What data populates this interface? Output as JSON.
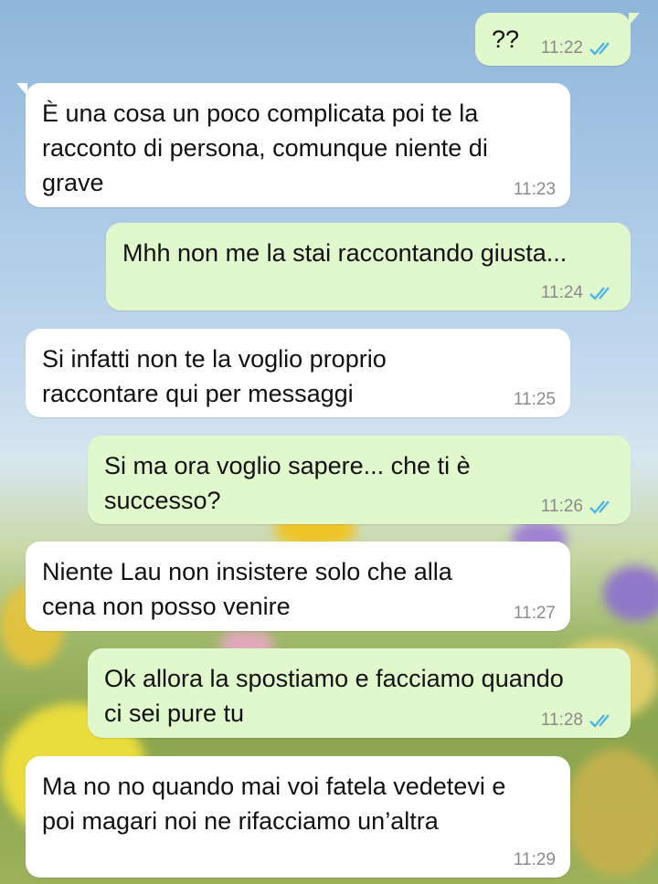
{
  "colors": {
    "incoming_bubble": "#ffffff",
    "outgoing_bubble": "#e1f8cd",
    "read_ticks": "#4fb4e8",
    "timestamp": "#8a8a8a"
  },
  "messages": [
    {
      "direction": "out",
      "text": "??",
      "time": "11:22",
      "status": "read-double-check-icon"
    },
    {
      "direction": "in",
      "text": "È una cosa un poco complicata poi te la\nracconto di persona, comunque niente di\ngrave",
      "time": "11:23"
    },
    {
      "direction": "out",
      "text": "Mhh non me la stai raccontando giusta...",
      "time": "11:24",
      "status": "read-double-check-icon"
    },
    {
      "direction": "in",
      "text": "Si infatti non te la voglio proprio\nraccontare qui per messaggi",
      "time": "11:25"
    },
    {
      "direction": "out",
      "text": "Si ma ora voglio sapere... che ti è\nsuccesso?",
      "time": "11:26",
      "status": "read-double-check-icon"
    },
    {
      "direction": "in",
      "text": "Niente Lau non insistere solo che alla\ncena non posso venire",
      "time": "11:27"
    },
    {
      "direction": "out",
      "text": "Ok allora la spostiamo e facciamo quando\nci sei pure tu",
      "time": "11:28",
      "status": "read-double-check-icon"
    },
    {
      "direction": "in",
      "text": "Ma no no quando mai voi fatela vedetevi e\npoi magari noi ne rifacciamo un’altra",
      "time": "11:29"
    }
  ]
}
